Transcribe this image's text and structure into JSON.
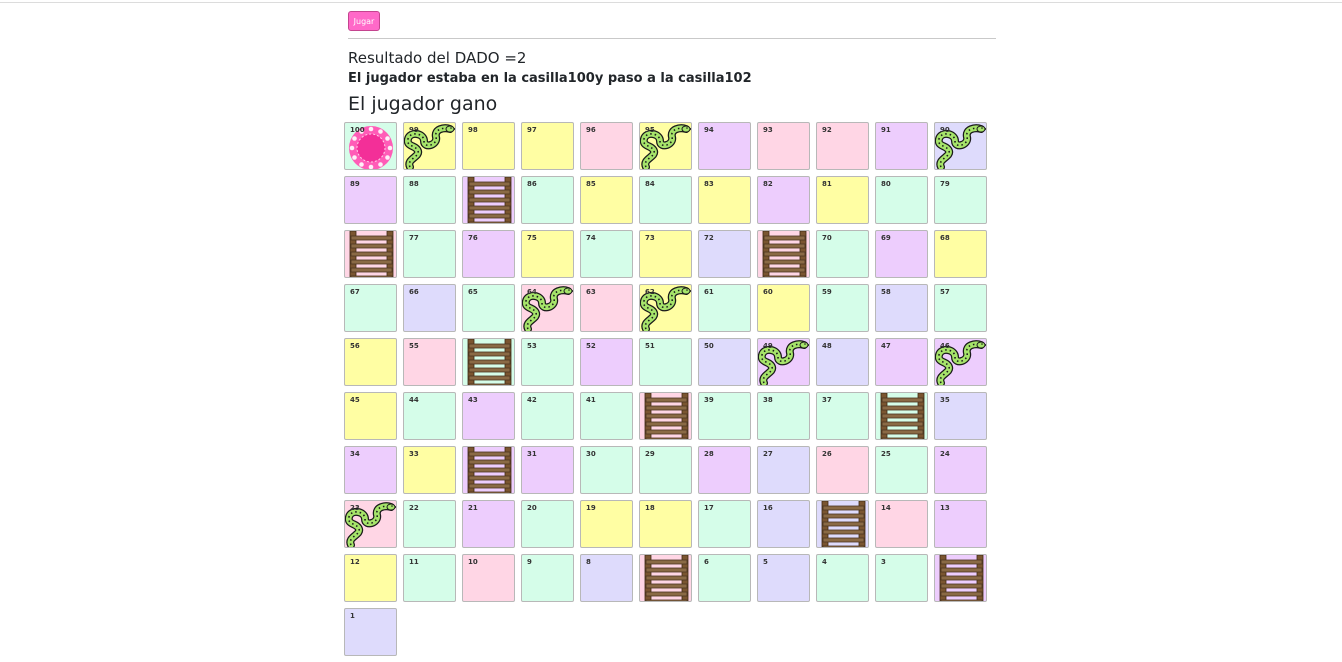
{
  "controls": {
    "play_label": "Jugar"
  },
  "status": {
    "dice_result": "Resultado del DADO =2",
    "move_message": "El jugador estaba en la casilla100y paso a la casilla102",
    "winner_message": "El jugador gano"
  },
  "colors": {
    "Y": "#fffea3",
    "P": "#ffd6e5",
    "V": "#edcdfd",
    "G": "#d5fde9",
    "L": "#dedbfc",
    "button": "#ff69c8"
  },
  "board": {
    "rows": [
      [
        {
          "n": "100",
          "c": "G",
          "item": "token"
        },
        {
          "n": "99",
          "c": "Y",
          "item": "snake"
        },
        {
          "n": "98",
          "c": "Y",
          "item": ""
        },
        {
          "n": "97",
          "c": "Y",
          "item": ""
        },
        {
          "n": "96",
          "c": "P",
          "item": ""
        },
        {
          "n": "95",
          "c": "Y",
          "item": "snake"
        },
        {
          "n": "94",
          "c": "V",
          "item": ""
        },
        {
          "n": "93",
          "c": "P",
          "item": ""
        },
        {
          "n": "92",
          "c": "P",
          "item": ""
        },
        {
          "n": "91",
          "c": "V",
          "item": ""
        },
        {
          "n": "90",
          "c": "L",
          "item": "snake"
        }
      ],
      [
        {
          "n": "89",
          "c": "V",
          "item": ""
        },
        {
          "n": "88",
          "c": "G",
          "item": ""
        },
        {
          "n": "",
          "c": "V",
          "item": "ladder"
        },
        {
          "n": "86",
          "c": "G",
          "item": ""
        },
        {
          "n": "85",
          "c": "Y",
          "item": ""
        },
        {
          "n": "84",
          "c": "G",
          "item": ""
        },
        {
          "n": "83",
          "c": "Y",
          "item": ""
        },
        {
          "n": "82",
          "c": "V",
          "item": ""
        },
        {
          "n": "81",
          "c": "Y",
          "item": ""
        },
        {
          "n": "80",
          "c": "G",
          "item": ""
        },
        {
          "n": "79",
          "c": "G",
          "item": ""
        }
      ],
      [
        {
          "n": "",
          "c": "P",
          "item": "ladder"
        },
        {
          "n": "77",
          "c": "G",
          "item": ""
        },
        {
          "n": "76",
          "c": "V",
          "item": ""
        },
        {
          "n": "75",
          "c": "Y",
          "item": ""
        },
        {
          "n": "74",
          "c": "G",
          "item": ""
        },
        {
          "n": "73",
          "c": "Y",
          "item": ""
        },
        {
          "n": "72",
          "c": "L",
          "item": ""
        },
        {
          "n": "",
          "c": "P",
          "item": "ladder"
        },
        {
          "n": "70",
          "c": "G",
          "item": ""
        },
        {
          "n": "69",
          "c": "V",
          "item": ""
        },
        {
          "n": "68",
          "c": "Y",
          "item": ""
        }
      ],
      [
        {
          "n": "67",
          "c": "G",
          "item": ""
        },
        {
          "n": "66",
          "c": "L",
          "item": ""
        },
        {
          "n": "65",
          "c": "G",
          "item": ""
        },
        {
          "n": "64",
          "c": "P",
          "item": "snake"
        },
        {
          "n": "63",
          "c": "P",
          "item": ""
        },
        {
          "n": "62",
          "c": "Y",
          "item": "snake"
        },
        {
          "n": "61",
          "c": "G",
          "item": ""
        },
        {
          "n": "60",
          "c": "Y",
          "item": ""
        },
        {
          "n": "59",
          "c": "G",
          "item": ""
        },
        {
          "n": "58",
          "c": "L",
          "item": ""
        },
        {
          "n": "57",
          "c": "G",
          "item": ""
        }
      ],
      [
        {
          "n": "56",
          "c": "Y",
          "item": ""
        },
        {
          "n": "55",
          "c": "P",
          "item": ""
        },
        {
          "n": "",
          "c": "G",
          "item": "ladder"
        },
        {
          "n": "53",
          "c": "G",
          "item": ""
        },
        {
          "n": "52",
          "c": "V",
          "item": ""
        },
        {
          "n": "51",
          "c": "G",
          "item": ""
        },
        {
          "n": "50",
          "c": "L",
          "item": ""
        },
        {
          "n": "49",
          "c": "V",
          "item": "snake"
        },
        {
          "n": "48",
          "c": "L",
          "item": ""
        },
        {
          "n": "47",
          "c": "V",
          "item": ""
        },
        {
          "n": "46",
          "c": "V",
          "item": "snake"
        }
      ],
      [
        {
          "n": "45",
          "c": "Y",
          "item": ""
        },
        {
          "n": "44",
          "c": "G",
          "item": ""
        },
        {
          "n": "43",
          "c": "V",
          "item": ""
        },
        {
          "n": "42",
          "c": "G",
          "item": ""
        },
        {
          "n": "41",
          "c": "G",
          "item": ""
        },
        {
          "n": "",
          "c": "P",
          "item": "ladder"
        },
        {
          "n": "39",
          "c": "G",
          "item": ""
        },
        {
          "n": "38",
          "c": "G",
          "item": ""
        },
        {
          "n": "37",
          "c": "G",
          "item": ""
        },
        {
          "n": "",
          "c": "G",
          "item": "ladder"
        },
        {
          "n": "35",
          "c": "L",
          "item": ""
        }
      ],
      [
        {
          "n": "34",
          "c": "V",
          "item": ""
        },
        {
          "n": "33",
          "c": "Y",
          "item": ""
        },
        {
          "n": "",
          "c": "V",
          "item": "ladder"
        },
        {
          "n": "31",
          "c": "V",
          "item": ""
        },
        {
          "n": "30",
          "c": "G",
          "item": ""
        },
        {
          "n": "29",
          "c": "G",
          "item": ""
        },
        {
          "n": "28",
          "c": "V",
          "item": ""
        },
        {
          "n": "27",
          "c": "L",
          "item": ""
        },
        {
          "n": "26",
          "c": "P",
          "item": ""
        },
        {
          "n": "25",
          "c": "G",
          "item": ""
        },
        {
          "n": "24",
          "c": "V",
          "item": ""
        }
      ],
      [
        {
          "n": "23",
          "c": "P",
          "item": "snake"
        },
        {
          "n": "22",
          "c": "G",
          "item": ""
        },
        {
          "n": "21",
          "c": "V",
          "item": ""
        },
        {
          "n": "20",
          "c": "G",
          "item": ""
        },
        {
          "n": "19",
          "c": "Y",
          "item": ""
        },
        {
          "n": "18",
          "c": "Y",
          "item": ""
        },
        {
          "n": "17",
          "c": "G",
          "item": ""
        },
        {
          "n": "16",
          "c": "L",
          "item": ""
        },
        {
          "n": "",
          "c": "L",
          "item": "ladder"
        },
        {
          "n": "14",
          "c": "P",
          "item": ""
        },
        {
          "n": "13",
          "c": "V",
          "item": ""
        }
      ],
      [
        {
          "n": "12",
          "c": "Y",
          "item": ""
        },
        {
          "n": "11",
          "c": "G",
          "item": ""
        },
        {
          "n": "10",
          "c": "P",
          "item": ""
        },
        {
          "n": "9",
          "c": "G",
          "item": ""
        },
        {
          "n": "8",
          "c": "L",
          "item": ""
        },
        {
          "n": "",
          "c": "P",
          "item": "ladder"
        },
        {
          "n": "6",
          "c": "G",
          "item": ""
        },
        {
          "n": "5",
          "c": "L",
          "item": ""
        },
        {
          "n": "4",
          "c": "G",
          "item": ""
        },
        {
          "n": "3",
          "c": "G",
          "item": ""
        },
        {
          "n": "",
          "c": "V",
          "item": "ladder"
        }
      ],
      [
        {
          "n": "1",
          "c": "L",
          "item": ""
        }
      ]
    ]
  }
}
